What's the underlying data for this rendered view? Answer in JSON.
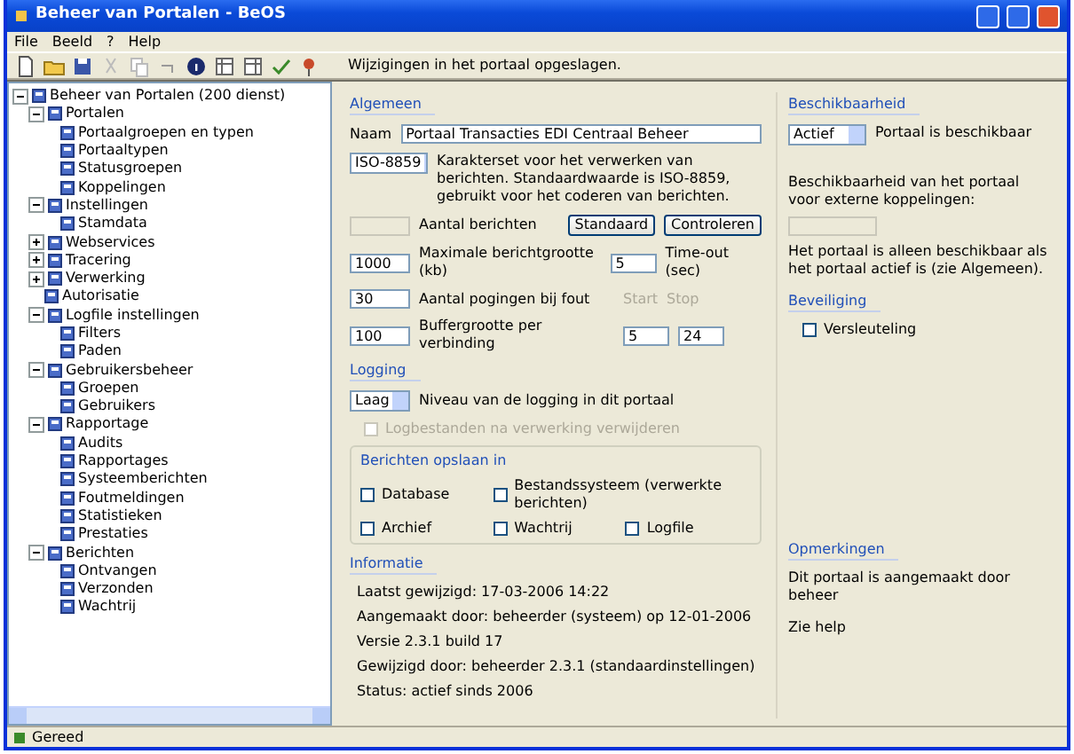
{
  "window": {
    "title": "Beheer van Portalen - BeOS"
  },
  "menu": [
    "File",
    "Beeld",
    "?",
    "Help"
  ],
  "toolbar": {
    "message": "Wijzigingen in het portaal opgeslagen."
  },
  "tree": [
    {
      "label": "Beheer van Portalen (200 dienst)",
      "expanded": true,
      "children": [
        {
          "label": "Portalen",
          "expanded": true,
          "children": [
            {
              "label": "Portaalgroepen en typen"
            },
            {
              "label": "Portaaltypen"
            },
            {
              "label": "Statusgroepen"
            },
            {
              "label": "Koppelingen"
            }
          ]
        },
        {
          "label": "Instellingen",
          "expanded": true,
          "children": [
            {
              "label": "Stamdata"
            }
          ]
        },
        {
          "label": "Webservices",
          "expanded": false
        },
        {
          "label": "Tracering",
          "expanded": false
        },
        {
          "label": "Verwerking",
          "expanded": false
        },
        {
          "label": "Autorisatie"
        },
        {
          "label": "Logfile instellingen",
          "expanded": true,
          "children": [
            {
              "label": "Filters"
            },
            {
              "label": "Paden"
            }
          ]
        },
        {
          "label": "Gebruikersbeheer",
          "expanded": true,
          "children": [
            {
              "label": "Groepen"
            },
            {
              "label": "Gebruikers"
            }
          ]
        },
        {
          "label": "Rapportage",
          "expanded": true,
          "children": [
            {
              "label": "Audits"
            },
            {
              "label": "Rapportages"
            },
            {
              "label": "Systeemberichten"
            },
            {
              "label": "Foutmeldingen"
            },
            {
              "label": "Statistieken"
            },
            {
              "label": "Prestaties"
            }
          ]
        },
        {
          "label": "Berichten",
          "expanded": true,
          "children": [
            {
              "label": "Ontvangen"
            },
            {
              "label": "Verzonden"
            },
            {
              "label": "Wachtrij"
            }
          ]
        }
      ]
    }
  ],
  "general": {
    "heading": "Algemeen",
    "name_label": "Naam",
    "name_value": "Portaal Transacties EDI Centraal Beheer",
    "charset": "ISO-8859",
    "charset_text": "Karakterset voor het verwerken van berichten. Standaardwaarde is ISO-8859, gebruikt voor het coderen van berichten.",
    "rows": [
      {
        "kind": "buttons",
        "value": "",
        "disabled": true,
        "label": "Aantal berichten",
        "buttons": [
          "Standaard",
          "Controleren"
        ]
      },
      {
        "kind": "pair",
        "value": "1000",
        "label": "Maximale berichtgrootte (kb)",
        "value2": "5",
        "label2": "Time-out (sec)"
      },
      {
        "kind": "range",
        "value": "30",
        "label": "Aantal pogingen bij fout",
        "from": "Start",
        "to": "Stop"
      },
      {
        "kind": "double",
        "value": "100",
        "label": "Buffergrootte per verbinding",
        "value2": "5",
        "value3": "24"
      }
    ]
  },
  "logging": {
    "heading": "Logging",
    "level": "Laag",
    "text": "Niveau van de logging in dit portaal",
    "option": {
      "label": "Logbestanden na verwerking verwijderen",
      "checked": false,
      "disabled": true
    }
  },
  "storage": {
    "legend": "Berichten opslaan in",
    "options": [
      {
        "label": "Database",
        "checked": false
      },
      {
        "label": "Bestandssysteem (verwerkte berichten)",
        "checked": false
      },
      {
        "label": "Archief",
        "checked": false
      },
      {
        "label": "Wachtrij",
        "checked": false
      },
      {
        "label": "Logfile",
        "checked": false
      }
    ]
  },
  "info": {
    "heading": "Informatie",
    "lines": [
      "Laatst gewijzigd: 17-03-2006 14:22",
      "Aangemaakt door: beheerder (systeem) op 12-01-2006",
      "Versie 2.3.1 build 17",
      "Gewijzigd door: beheerder 2.3.1 (standaardinstellingen)",
      "Status: actief sinds 2006"
    ]
  },
  "availability": {
    "heading": "Beschikbaarheid",
    "status": "Actief",
    "status_text": "Portaal is beschikbaar",
    "note": "Beschikbaarheid van het portaal voor externe koppelingen:",
    "field_disabled": true,
    "note2": "Het portaal is alleen beschikbaar als het portaal actief is (zie Algemeen)."
  },
  "security": {
    "heading": "Beveiliging",
    "options": [
      {
        "label": "Versleuteling",
        "checked": false
      }
    ]
  },
  "remarks": {
    "heading": "Opmerkingen",
    "lines": [
      "Dit portaal is aangemaakt door beheer",
      "Zie help"
    ]
  },
  "status_bar": {
    "text": "Gereed"
  }
}
